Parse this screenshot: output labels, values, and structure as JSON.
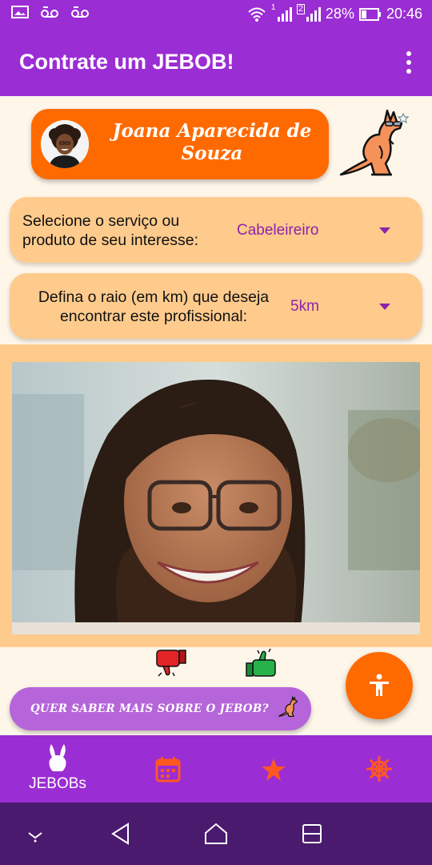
{
  "status_bar": {
    "battery": "28%",
    "time": "20:46",
    "sim_badge": "2",
    "signal_badge": "1"
  },
  "app_bar": {
    "title": "Contrate um JEBOB!",
    "menu_icon": "more-vert-icon"
  },
  "user": {
    "name": "Joana Aparecida de Souza"
  },
  "service_select": {
    "label": "Selecione o serviço ou produto de seu interesse:",
    "value": "Cabeleireiro"
  },
  "radius_select": {
    "label": "Defina o raio (em km) que deseja encontrar este profissional:",
    "value": "5km"
  },
  "actions": {
    "dislike_icon": "thumbs-down-icon",
    "like_icon": "thumbs-up-icon",
    "accessibility_icon": "accessibility-icon",
    "more_info_label": "QUER SABER MAIS SOBRE O JEBOB?"
  },
  "bottom_nav": {
    "items": [
      {
        "label": "JEBOBs",
        "icon": "rabbit-icon"
      },
      {
        "label": "",
        "icon": "calendar-icon"
      },
      {
        "label": "",
        "icon": "star-icon"
      },
      {
        "label": "",
        "icon": "ship-wheel-icon"
      }
    ]
  },
  "colors": {
    "primary": "#9B2DD4",
    "accent": "#FF6A00",
    "card": "#FFCB8C",
    "background": "#FFF6EA",
    "select_text": "#8E24AA"
  }
}
